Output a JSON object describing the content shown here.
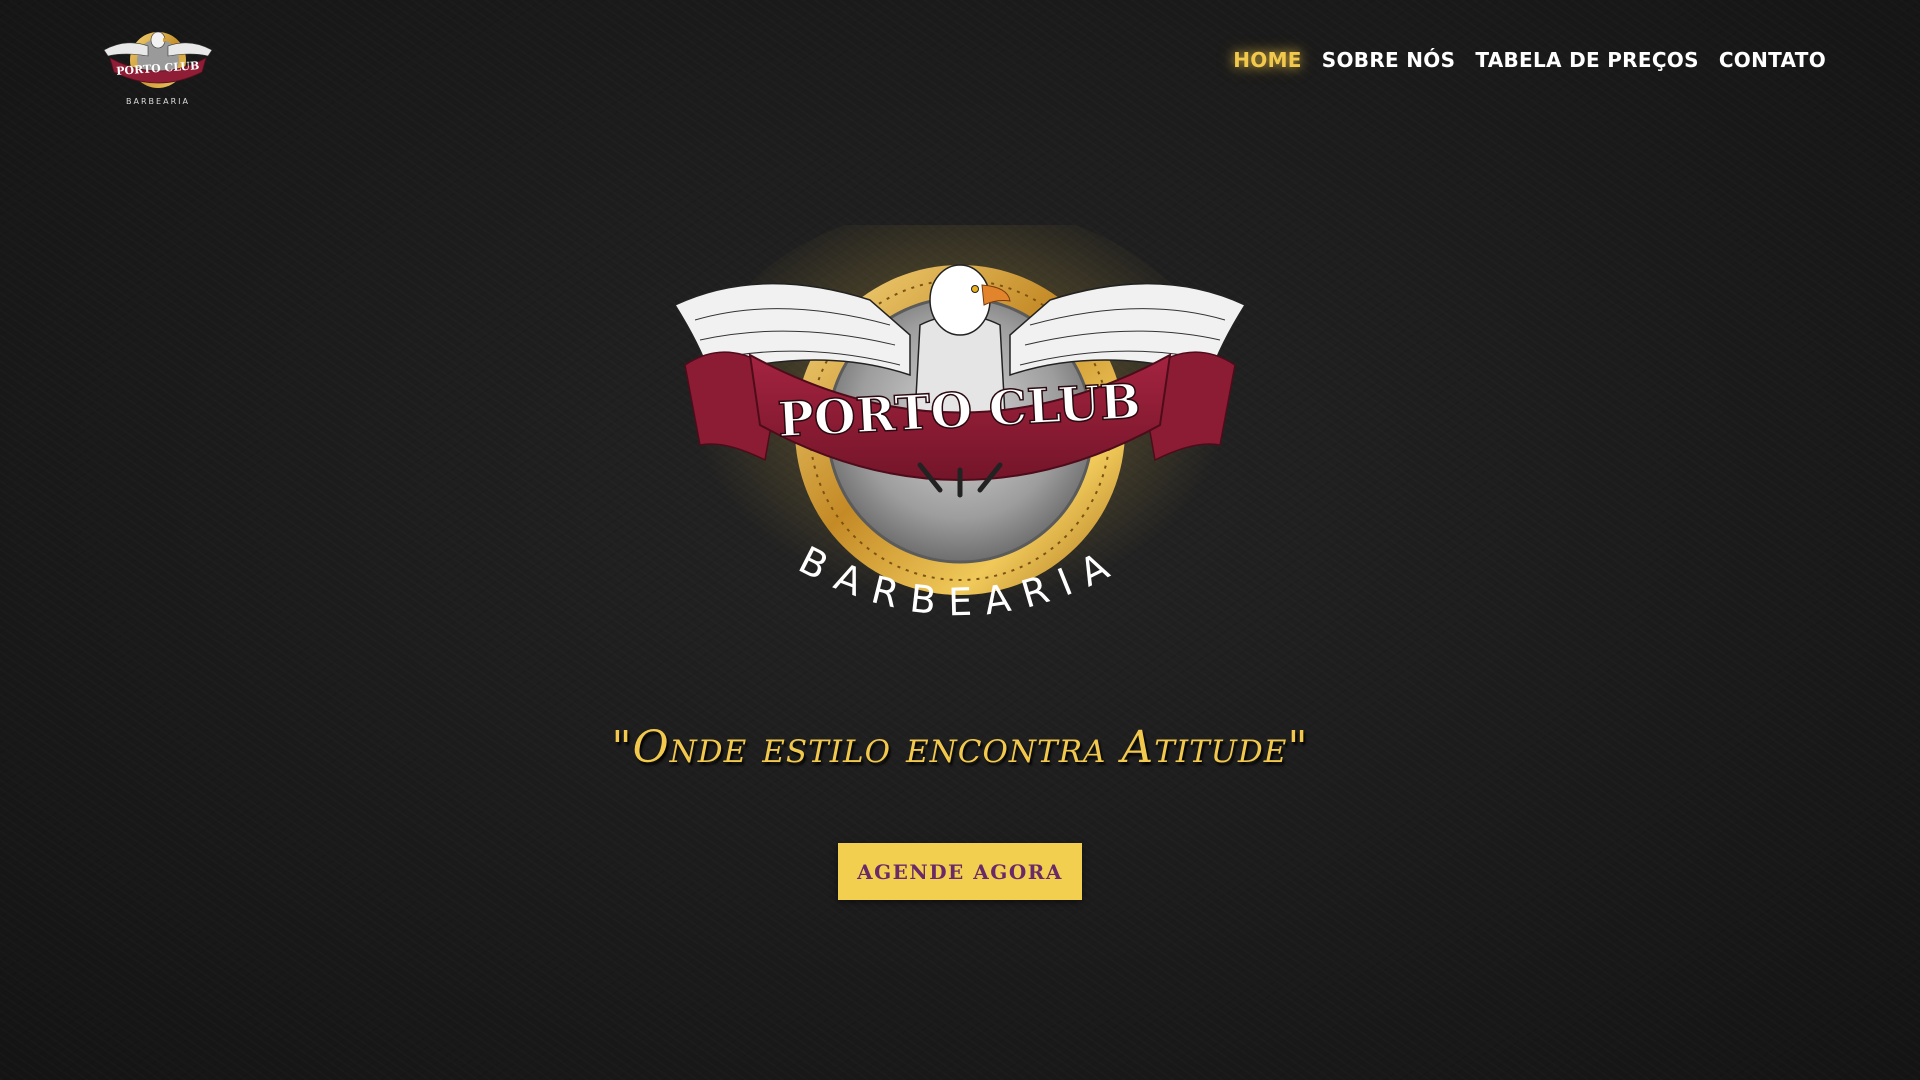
{
  "header": {
    "logo": {
      "brand": "PORTO CLUB",
      "sub": "BARBEARIA"
    },
    "nav": [
      {
        "label": "HOME",
        "active": true
      },
      {
        "label": "SOBRE NÓS",
        "active": false
      },
      {
        "label": "TABELA DE PREÇOS",
        "active": false
      },
      {
        "label": "CONTATO",
        "active": false
      }
    ]
  },
  "hero": {
    "logo": {
      "brand": "PORTO CLUB",
      "sub": "BARBEARIA"
    },
    "tagline": "\"Onde estilo encontra Atitude\"",
    "cta_label": "AGENDE AGORA"
  },
  "colors": {
    "accent": "#f2c94c",
    "cta_text": "#6a2a6a",
    "ribbon": "#8e1d35",
    "background": "#1b1b1b"
  }
}
